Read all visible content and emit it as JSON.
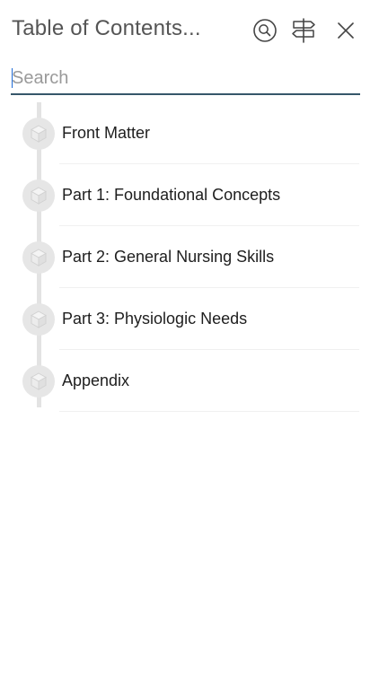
{
  "header": {
    "title": "Table of Contents...",
    "buttons": [
      {
        "name": "search-toggle-button",
        "icon": "magnifier-circle-icon"
      },
      {
        "name": "navigation-button",
        "icon": "signpost-icon"
      },
      {
        "name": "close-button",
        "icon": "close-icon"
      }
    ]
  },
  "search": {
    "placeholder": "Search",
    "value": ""
  },
  "toc": {
    "items": [
      {
        "label": "Front Matter",
        "icon": "cube-icon"
      },
      {
        "label": "Part 1: Foundational Concepts",
        "icon": "cube-icon"
      },
      {
        "label": "Part 2: General Nursing Skills",
        "icon": "cube-icon"
      },
      {
        "label": "Part 3: Physiologic Needs",
        "icon": "cube-icon"
      },
      {
        "label": "Appendix",
        "icon": "cube-icon"
      }
    ]
  },
  "colors": {
    "accent_underline": "#36576a",
    "node_fill": "#e6e6e6",
    "spine": "#e3e3e3"
  }
}
